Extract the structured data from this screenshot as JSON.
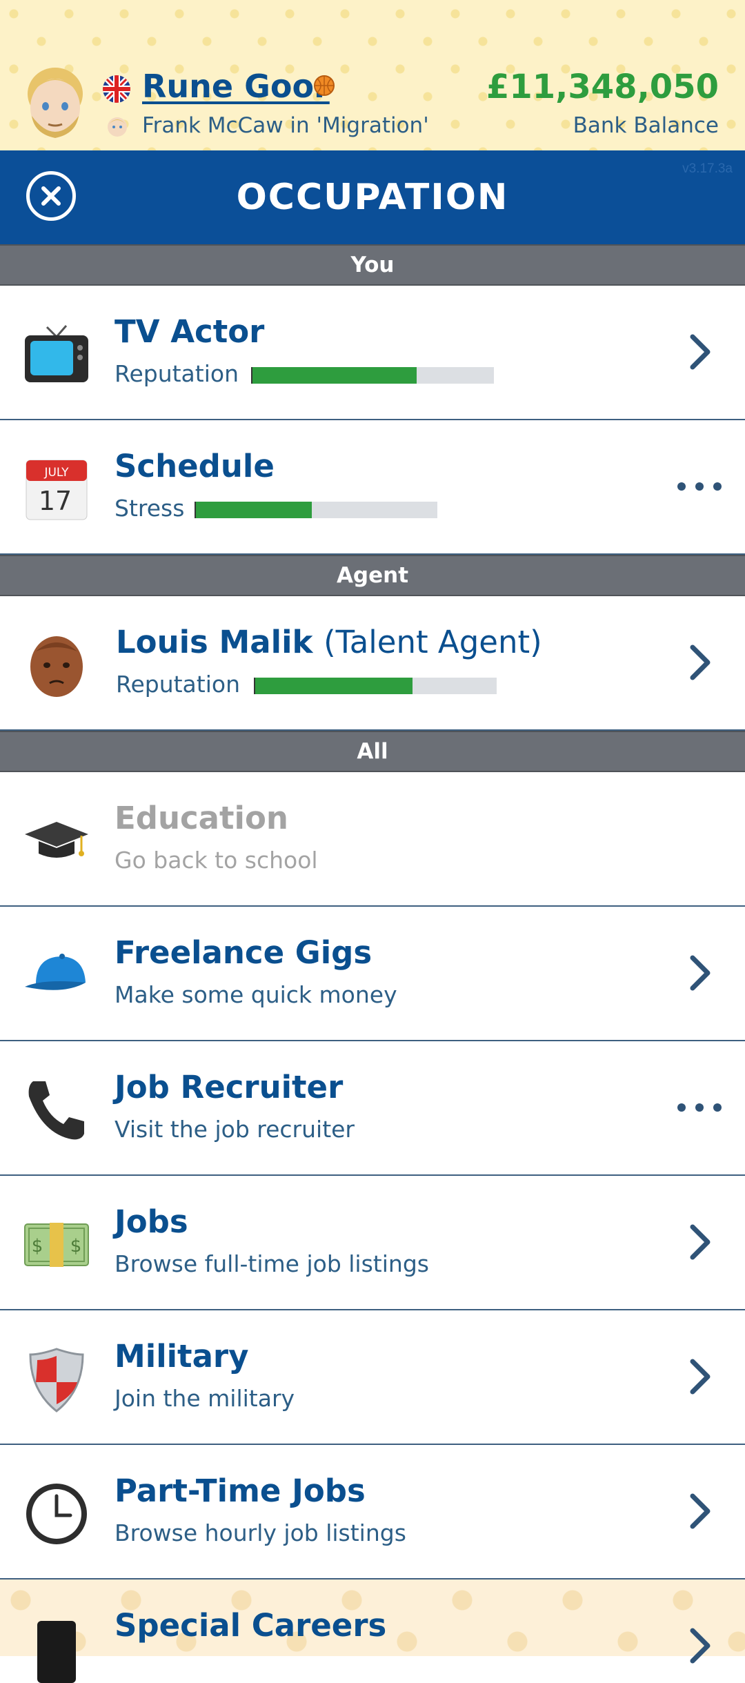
{
  "header": {
    "character_name": "Rune Goor",
    "subtitle": "Frank McCaw in 'Migration'",
    "bank_balance": "£11,348,050",
    "bank_balance_label": "Bank Balance"
  },
  "titlebar": {
    "title": "OCCUPATION",
    "version": "v3.17.3a"
  },
  "sections": {
    "you": "You",
    "agent": "Agent",
    "all": "All"
  },
  "you": {
    "job": {
      "title": "TV Actor",
      "stat_label": "Reputation",
      "stat_level": 0.68
    },
    "schedule": {
      "title": "Schedule",
      "stat_label": "Stress",
      "stat_level": 0.48,
      "calendar_month": "JULY",
      "calendar_day": "17"
    }
  },
  "agent": {
    "name": "Louis Malik",
    "role": "(Talent Agent)",
    "stat_label": "Reputation",
    "stat_level": 0.65
  },
  "all": [
    {
      "title": "Education",
      "subtitle": "Go back to school",
      "enabled": false,
      "action": "none",
      "icon": "graduation-cap-icon"
    },
    {
      "title": "Freelance Gigs",
      "subtitle": "Make some quick money",
      "enabled": true,
      "action": "chevron",
      "icon": "baseball-cap-icon"
    },
    {
      "title": "Job Recruiter",
      "subtitle": "Visit the job recruiter",
      "enabled": true,
      "action": "dots",
      "icon": "phone-icon"
    },
    {
      "title": "Jobs",
      "subtitle": "Browse full-time job listings",
      "enabled": true,
      "action": "chevron",
      "icon": "money-icon"
    },
    {
      "title": "Military",
      "subtitle": "Join the military",
      "enabled": true,
      "action": "chevron",
      "icon": "shield-icon"
    },
    {
      "title": "Part-Time Jobs",
      "subtitle": "Browse hourly job listings",
      "enabled": true,
      "action": "chevron",
      "icon": "clock-icon"
    },
    {
      "title": "Special Careers",
      "subtitle": "",
      "enabled": true,
      "action": "chevron",
      "icon": "top-hat-icon"
    }
  ],
  "colors": {
    "brand_blue": "#0b4f98",
    "text_blue": "#0a4f8f",
    "money_green": "#2e9d3e",
    "section_gray": "#6b6f76"
  }
}
